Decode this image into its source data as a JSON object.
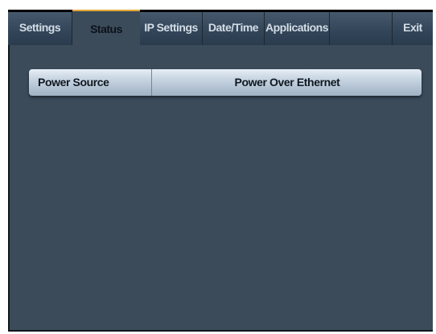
{
  "tabs": [
    {
      "label": "Settings"
    },
    {
      "label": "Status"
    },
    {
      "label": "IP Settings"
    },
    {
      "label": "Date/Time"
    },
    {
      "label": "Applications"
    },
    {
      "label": ""
    },
    {
      "label": "Exit"
    }
  ],
  "active_tab": "Status",
  "status": {
    "power_source": {
      "label": "Power Source",
      "value": "Power Over Ethernet"
    }
  },
  "colors": {
    "background": "#3b4b5a",
    "tab_background": "#33465a",
    "active_tab_accent": "#e0a733",
    "row_background": "#c9d6e3"
  }
}
